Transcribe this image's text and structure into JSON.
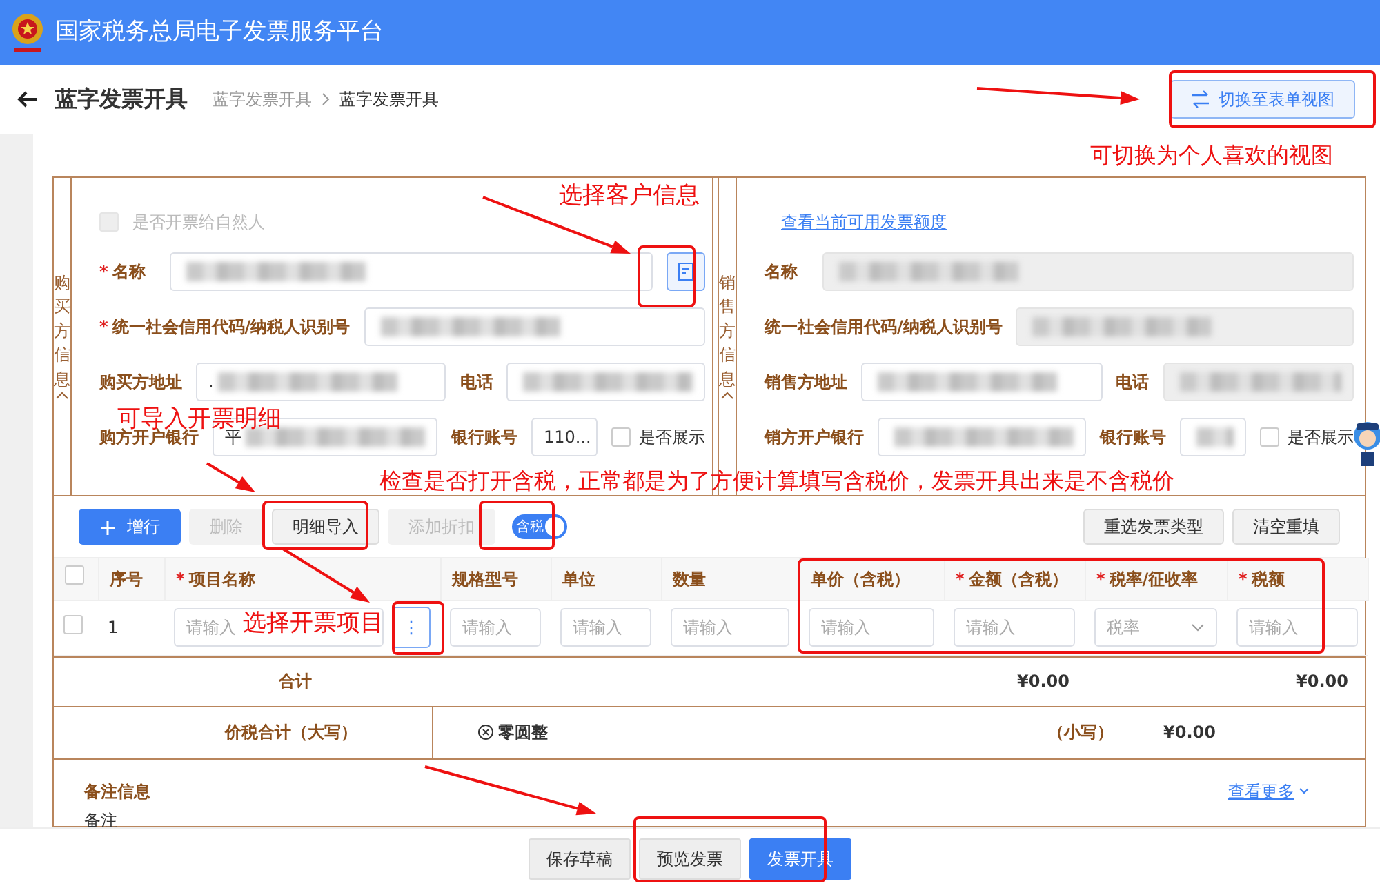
{
  "header": {
    "title": "国家税务总局电子发票服务平台"
  },
  "page": {
    "title": "蓝字发票开具",
    "breadcrumbs": [
      {
        "label": "蓝字发票开具",
        "current": false
      },
      {
        "label": "蓝字发票开具",
        "current": true
      }
    ],
    "switch_button": "切换至表单视图"
  },
  "buyer": {
    "section_label": "购买方信息",
    "natural_person": {
      "label": "是否开票给自然人",
      "checked": false,
      "disabled": true
    },
    "rows": [
      [
        {
          "marker": "*",
          "label": "名称",
          "redacted": true,
          "picker": true
        }
      ],
      [
        {
          "marker": "*",
          "label": "统一社会信用代码/纳税人识别号",
          "redacted": true
        }
      ],
      [
        {
          "label": "购买方地址",
          "value": ".",
          "redacted": true
        },
        {
          "label": "电话",
          "redacted": true
        }
      ],
      [
        {
          "label": "购方开户银行",
          "value": "平",
          "redacted": true
        },
        {
          "label": "银行账号",
          "value": "110..."
        }
      ]
    ],
    "show_option": {
      "label": "是否展示",
      "checked": false
    }
  },
  "seller": {
    "section_label": "销售方信息",
    "quota_link": "查看当前可用发票额度",
    "rows": [
      [
        {
          "label": "名称",
          "redacted": true,
          "disabled": true
        }
      ],
      [
        {
          "label": "统一社会信用代码/纳税人识别号",
          "redacted": true,
          "disabled": true
        }
      ],
      [
        {
          "label": "销售方地址",
          "redacted": true
        },
        {
          "label": "电话",
          "redacted": true,
          "disabled": true
        }
      ],
      [
        {
          "label": "销方开户银行",
          "redacted": true
        },
        {
          "label": "银行账号",
          "redacted": true
        }
      ]
    ],
    "show_option": {
      "label": "是否展示",
      "checked": false
    }
  },
  "toolbar": {
    "buttons": [
      {
        "label": "增行",
        "kind": "primary"
      },
      {
        "label": "删除",
        "kind": "disabled"
      },
      {
        "label": "明细导入",
        "kind": "default"
      },
      {
        "label": "添加折扣",
        "kind": "disabled"
      }
    ],
    "tax_toggle": {
      "label": "含税",
      "on": true
    },
    "right_buttons": [
      "重选发票类型",
      "清空重填"
    ]
  },
  "table": {
    "all_selected": false,
    "columns": [
      {
        "label": "序号"
      },
      {
        "marker": "*",
        "label": "项目名称"
      },
      {
        "label": "规格型号"
      },
      {
        "label": "单位"
      },
      {
        "label": "数量"
      },
      {
        "label": "单价（含税）"
      },
      {
        "marker": "*",
        "label": "金额（含税）"
      },
      {
        "marker": "*",
        "label": "税率/征收率"
      },
      {
        "marker": "*",
        "label": "税额"
      }
    ],
    "rows": [
      {
        "selected": false,
        "cells": [
          {
            "kind": "text",
            "text": "1"
          },
          {
            "kind": "picker",
            "placeholder": "请输入",
            "button": "⋮"
          },
          {
            "kind": "input",
            "placeholder": "请输入"
          },
          {
            "kind": "input",
            "placeholder": "请输入"
          },
          {
            "kind": "input",
            "placeholder": "请输入"
          },
          {
            "kind": "input",
            "placeholder": "请输入"
          },
          {
            "kind": "input",
            "placeholder": "请输入"
          },
          {
            "kind": "select",
            "placeholder": "税率"
          },
          {
            "kind": "input",
            "placeholder": "请输入"
          }
        ]
      }
    ]
  },
  "totals": {
    "label": "合计",
    "amount": "¥0.00",
    "tax": "¥0.00"
  },
  "grand_total": {
    "label": "价税合计（大写）",
    "words": "零圆整",
    "small_label": "（小写）",
    "small_value": "¥0.00"
  },
  "remarks": {
    "title": "备注信息",
    "more_link": "查看更多",
    "label": "备注"
  },
  "footer": {
    "buttons": [
      {
        "label": "保存草稿",
        "kind": "secondary"
      },
      {
        "label": "预览发票",
        "kind": "secondary"
      },
      {
        "label": "发票开具",
        "kind": "primary"
      }
    ]
  },
  "annotations": [
    {
      "text": "可切换为个人喜欢的视图"
    },
    {
      "text": "选择客户信息"
    },
    {
      "text": "可导入开票明细"
    },
    {
      "text": "检查是否打开含税，正常都是为了方便计算填写含税价，发票开具出来是不含税价"
    },
    {
      "text": "选择开票项目"
    }
  ]
}
